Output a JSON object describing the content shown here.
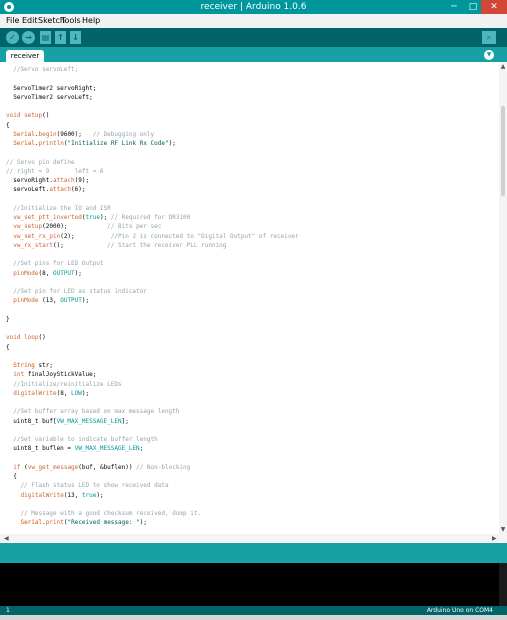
{
  "window": {
    "title": "receiver | Arduino 1.0.6",
    "min_glyph": "─",
    "max_glyph": "□",
    "close_glyph": "✕"
  },
  "menu": [
    "File",
    "Edit",
    "Sketch",
    "Tools",
    "Help"
  ],
  "toolbar": {
    "verify_glyph": "✓",
    "upload_glyph": "→",
    "new_glyph": "▤",
    "open_glyph": "↑",
    "save_glyph": "↓",
    "serial_monitor_glyph": "⌕"
  },
  "tabs": [
    {
      "label": "receiver"
    }
  ],
  "tab_menu_glyph": "▼",
  "editor": {
    "lines": [
      [
        {
          "t": "  //Servo servoLeft;",
          "c": "cm"
        }
      ],
      [
        {
          "t": ""
        }
      ],
      [
        {
          "t": "  ServoTimer2 servoRight;"
        }
      ],
      [
        {
          "t": "  ServoTimer2 servoLeft;"
        }
      ],
      [
        {
          "t": ""
        }
      ],
      [
        {
          "t": "void ",
          "c": "kw"
        },
        {
          "t": "setup",
          "c": "kw"
        },
        {
          "t": "()"
        }
      ],
      [
        {
          "t": "{"
        }
      ],
      [
        {
          "t": "  "
        },
        {
          "t": "Serial",
          "c": "lib"
        },
        {
          "t": "."
        },
        {
          "t": "begin",
          "c": "fn"
        },
        {
          "t": "(9600);   "
        },
        {
          "t": "// Debugging only",
          "c": "cm"
        }
      ],
      [
        {
          "t": "  "
        },
        {
          "t": "Serial",
          "c": "lib"
        },
        {
          "t": "."
        },
        {
          "t": "println",
          "c": "fn"
        },
        {
          "t": "("
        },
        {
          "t": "\"Initialize RF Link Rx Code\"",
          "c": "str"
        },
        {
          "t": ");"
        }
      ],
      [
        {
          "t": ""
        }
      ],
      [
        {
          "t": "// Servo pin define",
          "c": "cm"
        }
      ],
      [
        {
          "t": "// right = 9       left = 6",
          "c": "cm"
        }
      ],
      [
        {
          "t": "  servoRight."
        },
        {
          "t": "attach",
          "c": "fn"
        },
        {
          "t": "(9);"
        }
      ],
      [
        {
          "t": "  servoLeft."
        },
        {
          "t": "attach",
          "c": "fn"
        },
        {
          "t": "(6);"
        }
      ],
      [
        {
          "t": ""
        }
      ],
      [
        {
          "t": "  //Initialize the IO and ISR",
          "c": "cm"
        }
      ],
      [
        {
          "t": "  "
        },
        {
          "t": "vw_set_ptt_inverted",
          "c": "fn"
        },
        {
          "t": "("
        },
        {
          "t": "true",
          "c": "cst"
        },
        {
          "t": "); "
        },
        {
          "t": "// Required for DR3100",
          "c": "cm"
        }
      ],
      [
        {
          "t": "  "
        },
        {
          "t": "vw_setup",
          "c": "fn"
        },
        {
          "t": "(2000);           "
        },
        {
          "t": "// Bits per sec",
          "c": "cm"
        }
      ],
      [
        {
          "t": "  "
        },
        {
          "t": "vw_set_rx_pin",
          "c": "fn"
        },
        {
          "t": "(2);          "
        },
        {
          "t": "//Pin 2 is connected to \"Digital Output\" of receiver",
          "c": "cm"
        }
      ],
      [
        {
          "t": "  "
        },
        {
          "t": "vw_rx_start",
          "c": "fn"
        },
        {
          "t": "();            "
        },
        {
          "t": "// Start the receiver PLL running",
          "c": "cm"
        }
      ],
      [
        {
          "t": ""
        }
      ],
      [
        {
          "t": "  //Set pins for LED Output",
          "c": "cm"
        }
      ],
      [
        {
          "t": "  "
        },
        {
          "t": "pinMode",
          "c": "fn"
        },
        {
          "t": "(8, "
        },
        {
          "t": "OUTPUT",
          "c": "cst"
        },
        {
          "t": ");"
        }
      ],
      [
        {
          "t": ""
        }
      ],
      [
        {
          "t": "  //Set pin for LED as status indicator",
          "c": "cm"
        }
      ],
      [
        {
          "t": "  "
        },
        {
          "t": "pinMode",
          "c": "fn"
        },
        {
          "t": " (13, "
        },
        {
          "t": "OUTPUT",
          "c": "cst"
        },
        {
          "t": ");"
        }
      ],
      [
        {
          "t": ""
        }
      ],
      [
        {
          "t": "}"
        }
      ],
      [
        {
          "t": ""
        }
      ],
      [
        {
          "t": "void ",
          "c": "kw"
        },
        {
          "t": "loop",
          "c": "kw"
        },
        {
          "t": "()"
        }
      ],
      [
        {
          "t": "{"
        }
      ],
      [
        {
          "t": ""
        }
      ],
      [
        {
          "t": "  "
        },
        {
          "t": "String",
          "c": "lib"
        },
        {
          "t": " str;"
        }
      ],
      [
        {
          "t": "  "
        },
        {
          "t": "int",
          "c": "kw"
        },
        {
          "t": " finalJoyStickValue;"
        }
      ],
      [
        {
          "t": "  //Initialize/reinitialize LEDs",
          "c": "cm"
        }
      ],
      [
        {
          "t": "  "
        },
        {
          "t": "digitalWrite",
          "c": "fn"
        },
        {
          "t": "(8, "
        },
        {
          "t": "LOW",
          "c": "cst"
        },
        {
          "t": ");"
        }
      ],
      [
        {
          "t": ""
        }
      ],
      [
        {
          "t": "  //Set buffer array based on max message length",
          "c": "cm"
        }
      ],
      [
        {
          "t": "  uint8_t buf["
        },
        {
          "t": "VW_MAX_MESSAGE_LEN",
          "c": "cst"
        },
        {
          "t": "];"
        }
      ],
      [
        {
          "t": ""
        }
      ],
      [
        {
          "t": "  //Set variable to indicate buffer length",
          "c": "cm"
        }
      ],
      [
        {
          "t": "  uint8_t buflen = "
        },
        {
          "t": "VW_MAX_MESSAGE_LEN",
          "c": "cst"
        },
        {
          "t": ";"
        }
      ],
      [
        {
          "t": ""
        }
      ],
      [
        {
          "t": "  "
        },
        {
          "t": "if",
          "c": "kw"
        },
        {
          "t": " ("
        },
        {
          "t": "vw_get_message",
          "c": "fn"
        },
        {
          "t": "(buf, &buflen)) "
        },
        {
          "t": "// Non-blocking",
          "c": "cm"
        }
      ],
      [
        {
          "t": "  {"
        }
      ],
      [
        {
          "t": "    // Flash status LED to show received data",
          "c": "cm"
        }
      ],
      [
        {
          "t": "    "
        },
        {
          "t": "digitalWrite",
          "c": "fn"
        },
        {
          "t": "(13, "
        },
        {
          "t": "true",
          "c": "cst"
        },
        {
          "t": ");"
        }
      ],
      [
        {
          "t": ""
        }
      ],
      [
        {
          "t": "    // Message with a good checksum received, dump it.",
          "c": "cm"
        }
      ],
      [
        {
          "t": "    "
        },
        {
          "t": "Serial",
          "c": "lib"
        },
        {
          "t": "."
        },
        {
          "t": "print",
          "c": "fn"
        },
        {
          "t": "("
        },
        {
          "t": "\"Received message: \"",
          "c": "str"
        },
        {
          "t": ");"
        }
      ]
    ]
  },
  "scroll": {
    "up": "▲",
    "down": "▼",
    "left": "◀",
    "right": "▶"
  },
  "status": {
    "line": "1",
    "board": "Arduino Uno on COM4"
  },
  "colors": {
    "teal": "#00979c",
    "dark_teal": "#006468",
    "tab_teal": "#17a1a5",
    "close_red": "#d14836"
  }
}
